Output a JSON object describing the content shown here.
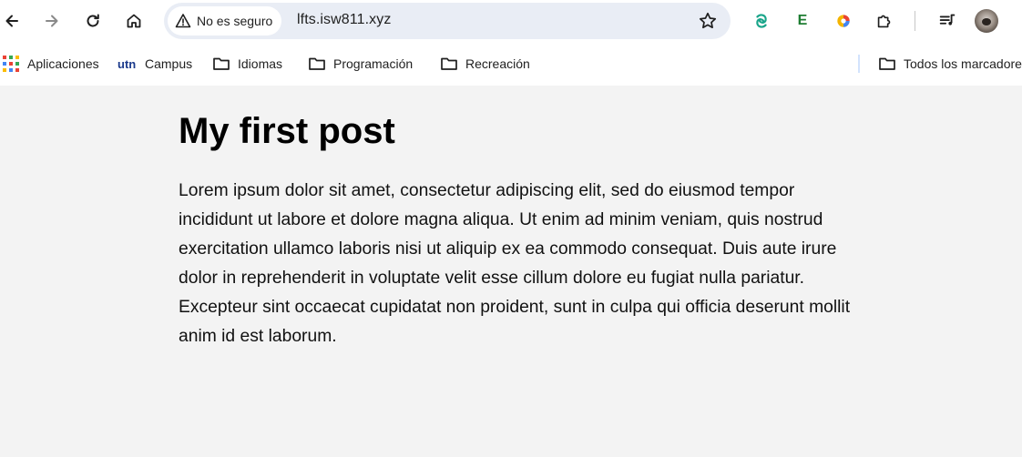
{
  "browser": {
    "security_label": "No es seguro",
    "url": "lfts.isw811.xyz",
    "extension_e_label": "E"
  },
  "bookmarks": {
    "items": [
      {
        "label": "Aplicaciones",
        "icon": "apps-grid-icon"
      },
      {
        "label": "Campus",
        "icon": "utn-logo-icon"
      },
      {
        "label": "Idiomas",
        "icon": "folder-icon"
      },
      {
        "label": "Programación",
        "icon": "folder-icon"
      },
      {
        "label": "Recreación",
        "icon": "folder-icon"
      }
    ],
    "all_bookmarks_label": "Todos los marcadores"
  },
  "post": {
    "title": "My first post",
    "body": "Lorem ipsum dolor sit amet, consectetur adipiscing elit, sed do eiusmod tempor incididunt ut labore et dolore magna aliqua. Ut enim ad minim veniam, quis nostrud exercitation ullamco laboris nisi ut aliquip ex ea commodo consequat. Duis aute irure dolor in reprehenderit in voluptate velit esse cillum dolore eu fugiat nulla pariatur. Excepteur sint occaecat cupidatat non proident, sunt in culpa qui officia deserunt mollit anim id est laborum."
  },
  "colors": {
    "omnibox_bg": "#e9edf5",
    "page_bg": "#f3f3f3",
    "bookmark_divider": "#d3e3fd"
  }
}
